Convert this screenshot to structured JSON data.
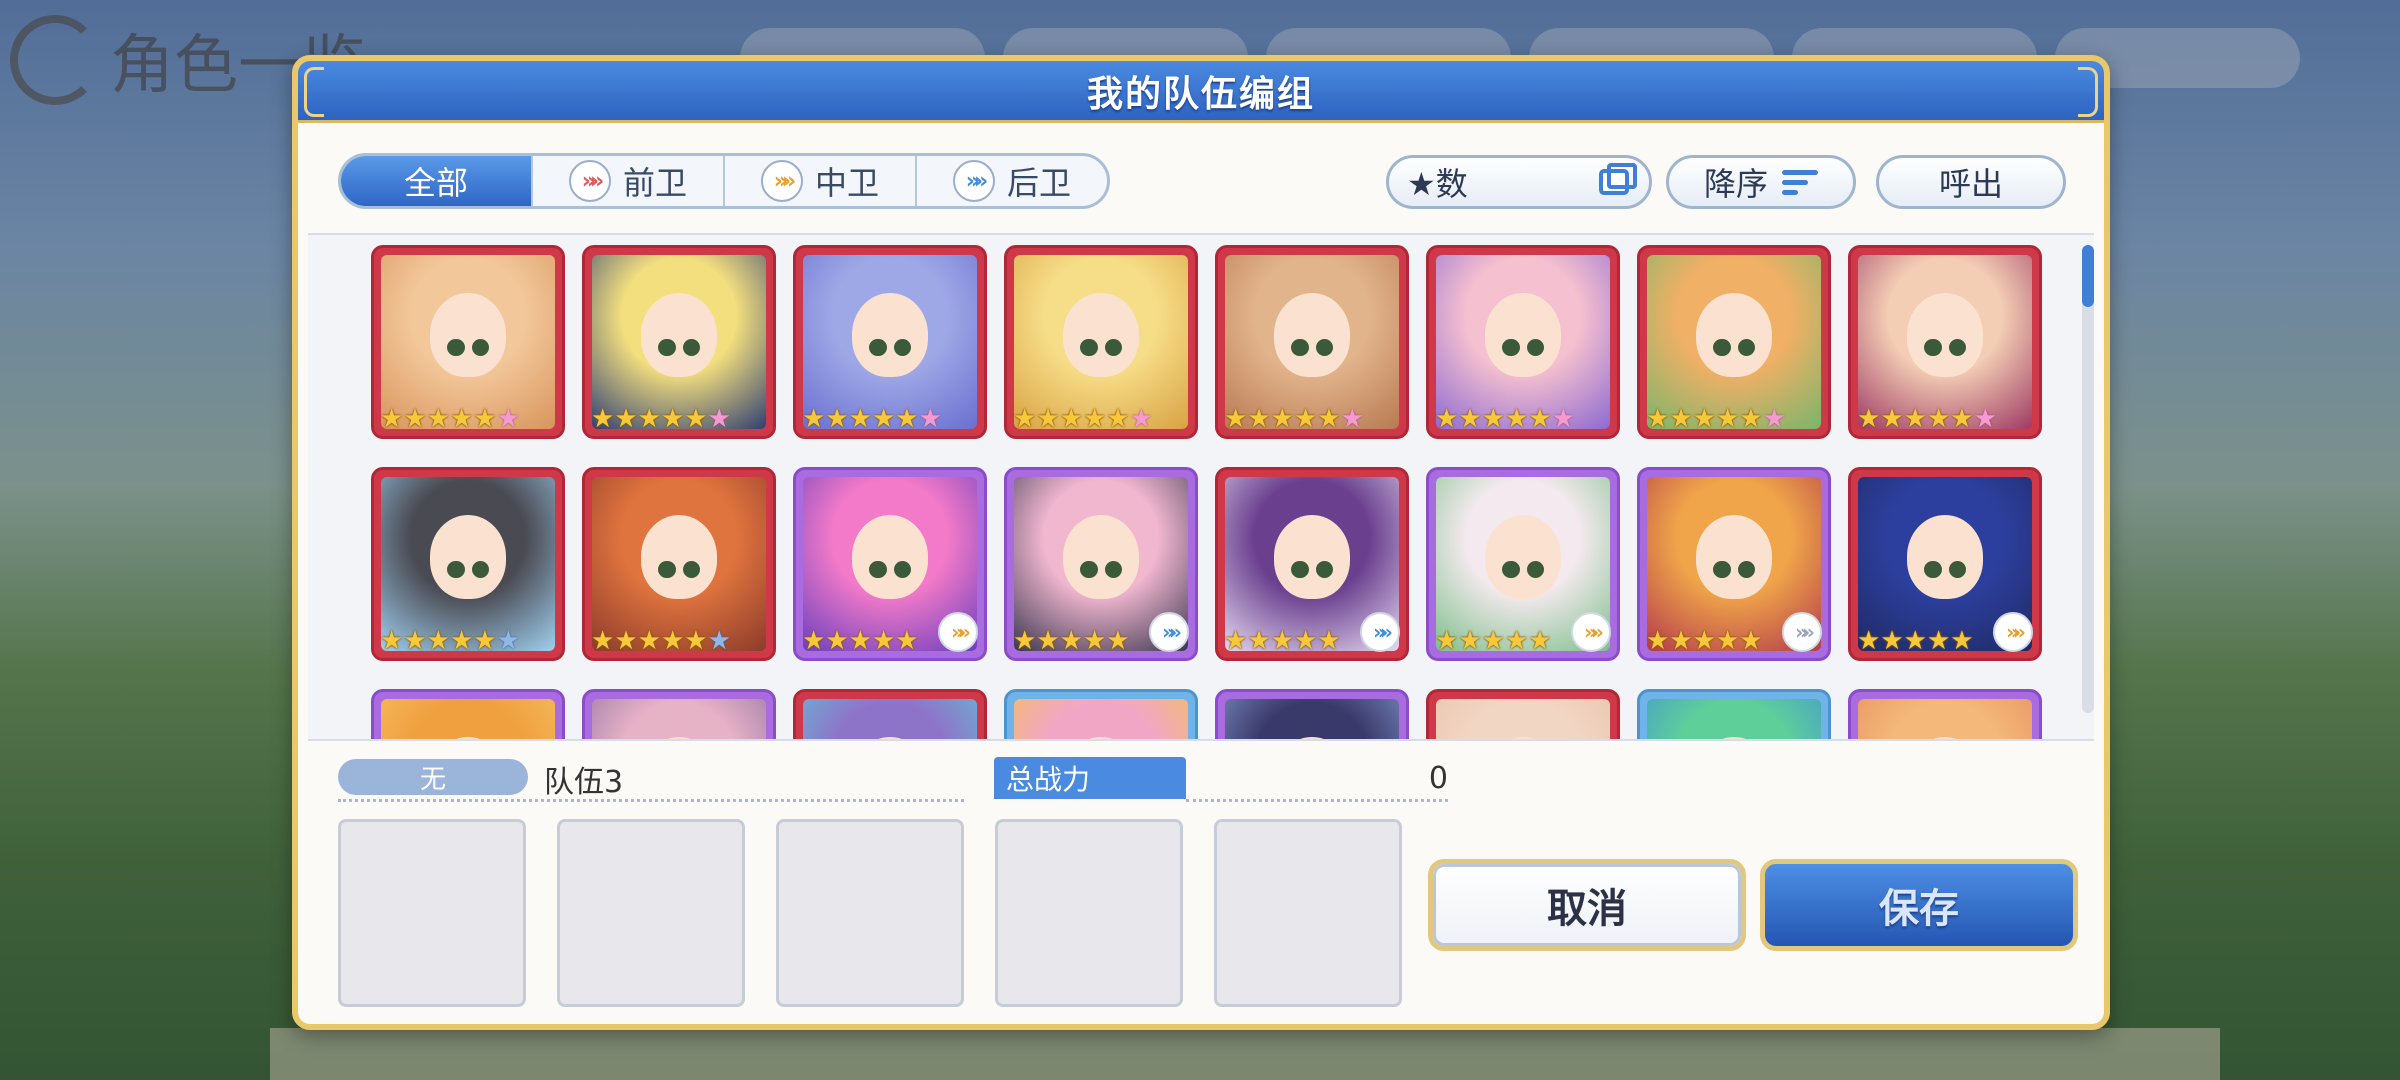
{
  "background": {
    "title": "角色一览"
  },
  "dialog": {
    "title": "我的队伍编组",
    "tabs": [
      {
        "label": "全部",
        "icon": null,
        "active": true
      },
      {
        "label": "前卫",
        "icon": "front-position-icon",
        "active": false
      },
      {
        "label": "中卫",
        "icon": "middle-position-icon",
        "active": false
      },
      {
        "label": "后卫",
        "icon": "back-position-icon",
        "active": false
      }
    ],
    "sort_key_label": "★数",
    "sort_order_label": "降序",
    "call_label": "呼出",
    "roster": {
      "rows": [
        [
          {
            "rarity": "red",
            "stars": 5,
            "extra": "pink-star",
            "palette": [
              "#f2c79a",
              "#d9955d"
            ]
          },
          {
            "rarity": "red",
            "stars": 5,
            "extra": "pink-star",
            "palette": [
              "#f3df7e",
              "#2f3f72"
            ]
          },
          {
            "rarity": "red",
            "stars": 5,
            "extra": "pink-star",
            "palette": [
              "#9fa8e6",
              "#6a6fd0"
            ]
          },
          {
            "rarity": "red",
            "stars": 5,
            "extra": "pink-star",
            "palette": [
              "#f6dd88",
              "#d9a243"
            ]
          },
          {
            "rarity": "red",
            "stars": 5,
            "extra": "pink-star",
            "palette": [
              "#e2b48c",
              "#b87a52"
            ]
          },
          {
            "rarity": "red",
            "stars": 5,
            "extra": "pink-star",
            "palette": [
              "#f5c0cf",
              "#8d6ad1"
            ]
          },
          {
            "rarity": "red",
            "stars": 5,
            "extra": "pink-star",
            "palette": [
              "#f0b066",
              "#7ab56a"
            ]
          },
          {
            "rarity": "red",
            "stars": 5,
            "extra": "pink-star",
            "palette": [
              "#f3cdb4",
              "#9e3a64"
            ]
          }
        ],
        [
          {
            "rarity": "red",
            "stars": 5,
            "extra": "blue-star",
            "palette": [
              "#4a4a52",
              "#9fd0f0"
            ]
          },
          {
            "rarity": "red",
            "stars": 5,
            "extra": "blue-star",
            "palette": [
              "#e0743e",
              "#8c3b2b"
            ]
          },
          {
            "rarity": "purple",
            "stars": 5,
            "extra": "mid",
            "palette": [
              "#f37ac8",
              "#6a3fbe"
            ]
          },
          {
            "rarity": "purple",
            "stars": 5,
            "extra": "back",
            "palette": [
              "#f1b7cf",
              "#3a3650"
            ]
          },
          {
            "rarity": "red",
            "stars": 5,
            "extra": "back",
            "palette": [
              "#6a3f8e",
              "#e4d8ef"
            ]
          },
          {
            "rarity": "purple",
            "stars": 5,
            "extra": "mid",
            "palette": [
              "#f3e9ee",
              "#7fbf8a"
            ]
          },
          {
            "rarity": "purple",
            "stars": 5,
            "extra": "grey",
            "palette": [
              "#f0a54a",
              "#b23a4a"
            ]
          },
          {
            "rarity": "red",
            "stars": 5,
            "extra": "mid",
            "palette": [
              "#2d3f9e",
              "#1f2a64"
            ]
          }
        ],
        [
          {
            "rarity": "purple",
            "palette": [
              "#f0a03e",
              "#f6c56a"
            ]
          },
          {
            "rarity": "purple",
            "palette": [
              "#e6b3c6",
              "#8a6aa0"
            ]
          },
          {
            "rarity": "red",
            "palette": [
              "#8e74c8",
              "#5ec9d8"
            ]
          },
          {
            "rarity": "blue",
            "palette": [
              "#f2a6c6",
              "#f3c44a"
            ]
          },
          {
            "rarity": "purple",
            "palette": [
              "#3a3a6a",
              "#8aa0d8"
            ]
          },
          {
            "rarity": "red",
            "palette": [
              "#f2d6c4",
              "#e6c0a8"
            ]
          },
          {
            "rarity": "blue",
            "palette": [
              "#5fcf9a",
              "#3e8fd6"
            ]
          },
          {
            "rarity": "purple",
            "palette": [
              "#f3b87a",
              "#e78a5a"
            ]
          }
        ]
      ]
    },
    "team": {
      "label": "无",
      "name": "队伍3",
      "power_label": "总战力",
      "power_value": "0",
      "slots": 5
    },
    "cancel_label": "取消",
    "save_label": "保存"
  }
}
